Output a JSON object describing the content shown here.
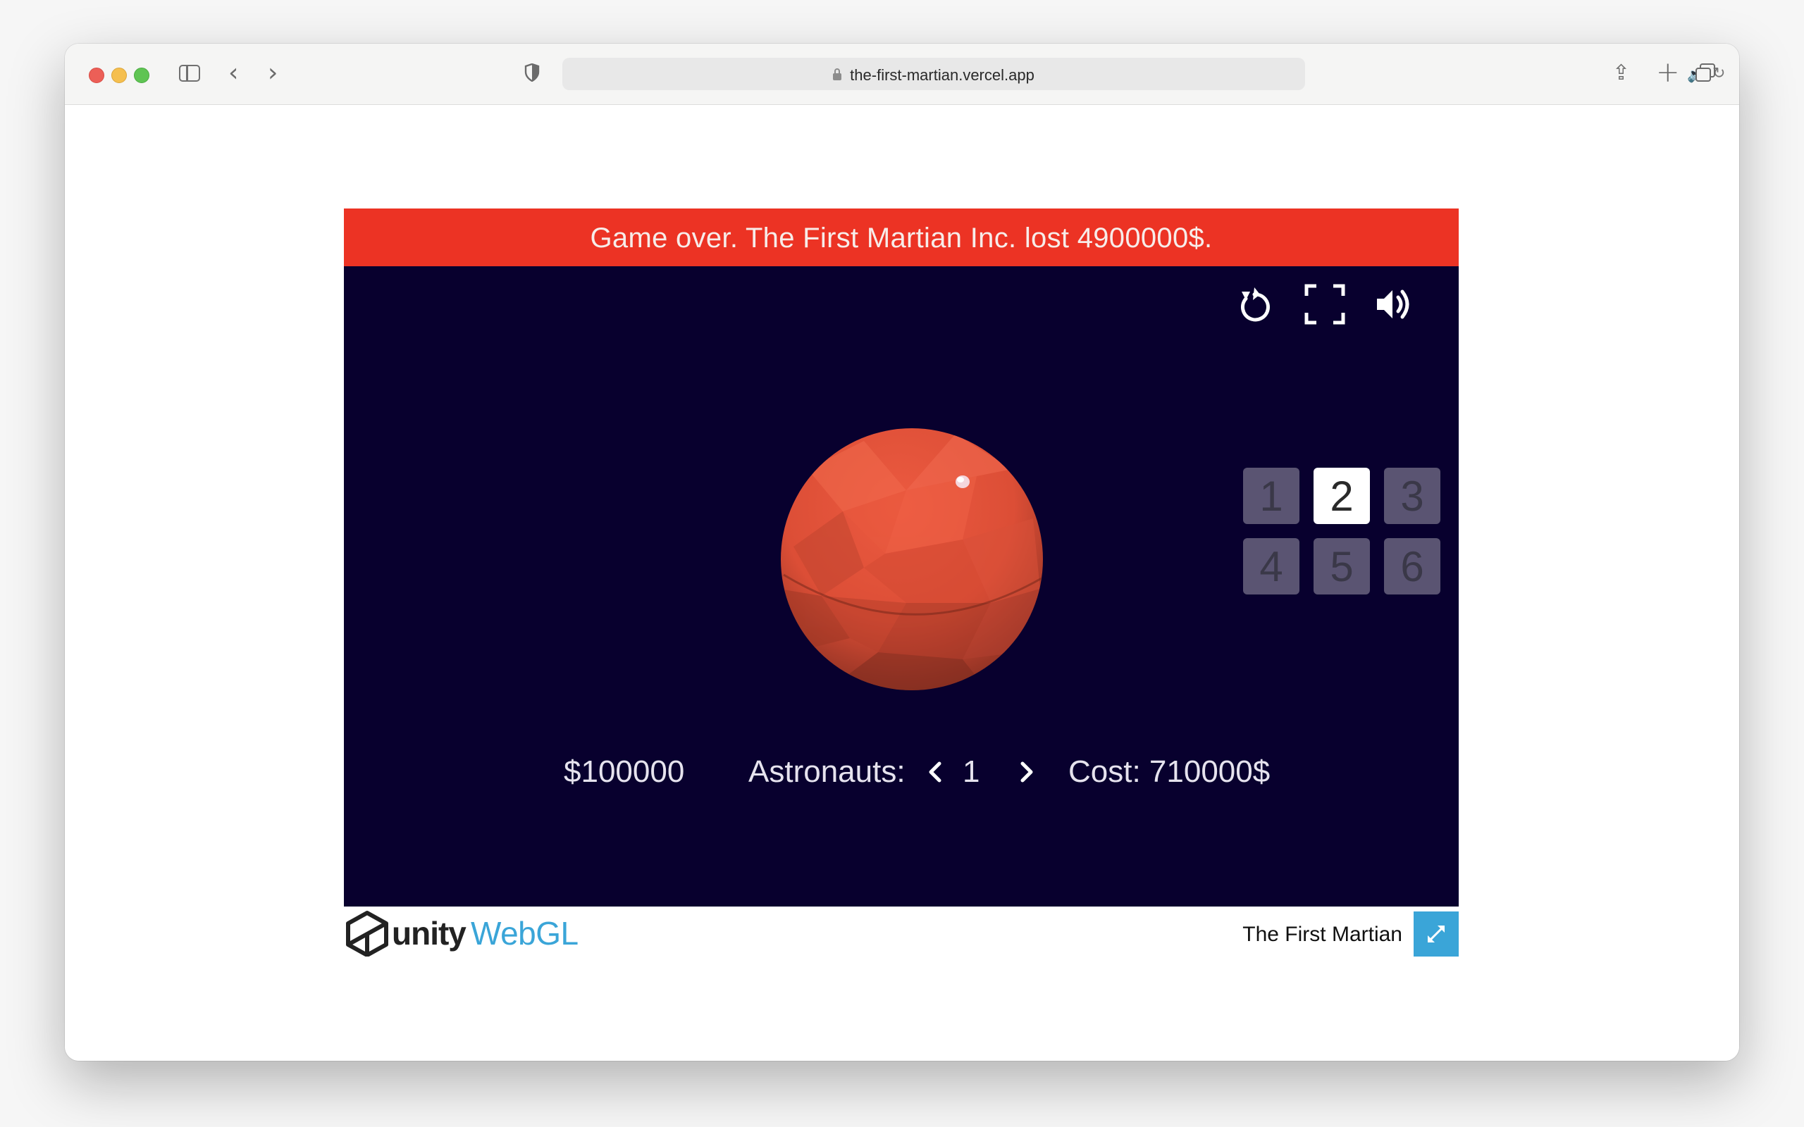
{
  "browser": {
    "url": "the-first-martian.vercel.app"
  },
  "game": {
    "banner": "Game over. The First Martian Inc. lost 4900000$.",
    "level_grid": [
      "1",
      "2",
      "3",
      "4",
      "5",
      "6"
    ],
    "selected_level": "2",
    "money": "$100000",
    "astronauts_label": "Astronauts:",
    "astronauts_count": "1",
    "cost": "Cost: 710000$",
    "colors": {
      "background": "#08002e",
      "banner": "#ec3324",
      "planet": "#e0513a"
    }
  },
  "footer": {
    "brand_unity": "unity",
    "brand_webgl": "WebGL",
    "title": "The First Martian"
  }
}
